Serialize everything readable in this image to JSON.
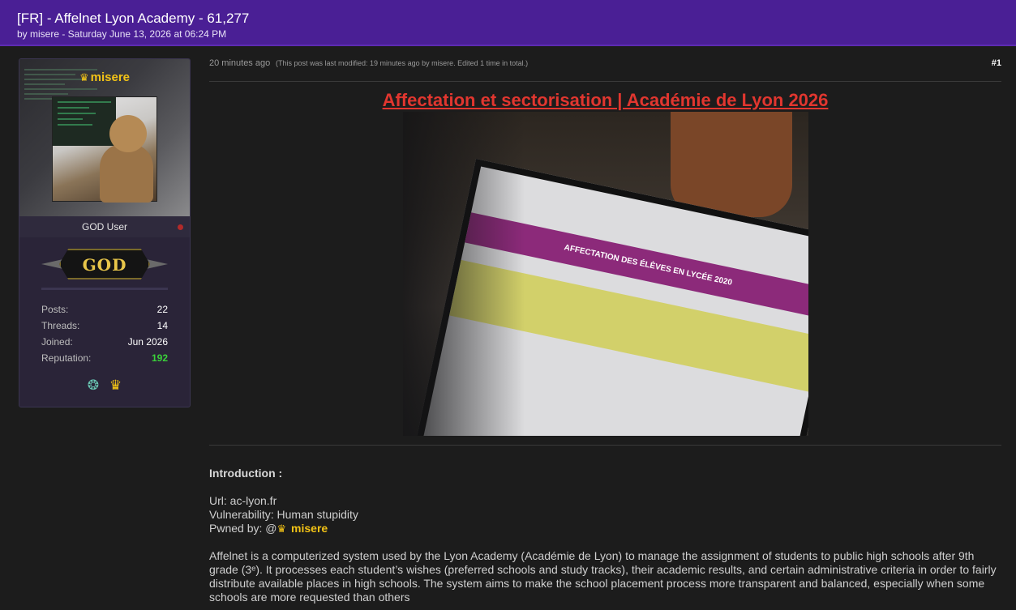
{
  "header": {
    "title": "[FR] - Affelnet Lyon Academy - 61,277",
    "byline": "by misere - Saturday June 13, 2026 at 06:24 PM"
  },
  "user": {
    "name": "misere",
    "rank": "GOD User",
    "badge_text": "GOD",
    "stats": {
      "posts_label": "Posts:",
      "posts": "22",
      "threads_label": "Threads:",
      "threads": "14",
      "joined_label": "Joined:",
      "joined": "Jun 2026",
      "reputation_label": "Reputation:",
      "reputation": "192"
    },
    "award_icons": [
      "globe-icon",
      "crown-icon"
    ],
    "status_color": "#b22a2a"
  },
  "post": {
    "time": "20 minutes ago",
    "edited_note": "(This post was last modified: 19 minutes ago by misere. Edited 1 time in total.)",
    "number": "#1",
    "heading": "Affectation et sectorisation | Académie de Lyon 2026",
    "image_banner": "AFFECTATION DES ÉLÈVES EN LYCÉE 2020",
    "intro_title": "Introduction :",
    "url_line": "Url: ac-lyon.fr",
    "vuln_line": "Vulnerability: Human stupidity",
    "pwned_prefix": "Pwned by: @",
    "pwned_user": "misere",
    "paragraph": "Affelnet is a computerized system used by the Lyon Academy (Académie de Lyon) to manage the assignment of students to public high schools after 9th grade (3ᵉ). It processes each student’s wishes (preferred schools and study tracks), their academic results, and certain administrative criteria in order to fairly distribute available places in high schools. The system aims to make the school placement process more transparent and balanced, especially when some schools are more requested than others"
  },
  "colors": {
    "header_bg": "#4a1f95",
    "username": "#f3c316",
    "heading_link": "#e1362f",
    "reputation": "#3ad13a"
  }
}
